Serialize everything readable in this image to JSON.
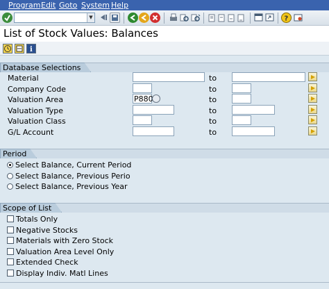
{
  "menu": [
    "Program",
    "Edit",
    "Goto",
    "System",
    "Help"
  ],
  "command_field": {
    "value": ""
  },
  "title": "List of Stock Values: Balances",
  "database_selections": {
    "heading": "Database Selections",
    "to_label": "to",
    "rows": [
      {
        "label": "Material",
        "from": "",
        "to": ""
      },
      {
        "label": "Company Code",
        "from": "",
        "to": ""
      },
      {
        "label": "Valuation Area",
        "from": "P880",
        "to": ""
      },
      {
        "label": "Valuation Type",
        "from": "",
        "to": ""
      },
      {
        "label": "Valuation Class",
        "from": "",
        "to": ""
      },
      {
        "label": "G/L Account",
        "from": "",
        "to": ""
      }
    ]
  },
  "period": {
    "heading": "Period",
    "options": [
      {
        "label": "Select Balance, Current Period",
        "selected": true
      },
      {
        "label": "Select Balance, Previous Perio",
        "selected": false
      },
      {
        "label": "Select Balance, Previous Year",
        "selected": false
      }
    ]
  },
  "scope": {
    "heading": "Scope of List",
    "options": [
      {
        "label": "Totals Only",
        "checked": false
      },
      {
        "label": "Negative Stocks",
        "checked": false
      },
      {
        "label": "Materials with Zero Stock",
        "checked": false
      },
      {
        "label": "Valuation Area Level Only",
        "checked": false
      },
      {
        "label": "Extended Check",
        "checked": false
      },
      {
        "label": "Display Indiv. Matl Lines",
        "checked": false
      }
    ]
  },
  "icons": [
    "enter-icon",
    "back-icon",
    "exit-icon",
    "cancel-icon",
    "print-icon",
    "find-icon",
    "find-next-icon",
    "first-page-icon",
    "previous-page-icon",
    "next-page-icon",
    "last-page-icon",
    "create-session-icon",
    "shortcut-icon",
    "help-icon",
    "customize-layout-icon",
    "execute-icon",
    "get-variant-icon",
    "info-icon",
    "multiple-selection-icon",
    "matchcode-icon"
  ],
  "colors": {
    "menubar": "#3a63ae",
    "background": "#dde8f0",
    "header": "#cfdce7",
    "accent": "#f7d54a"
  }
}
